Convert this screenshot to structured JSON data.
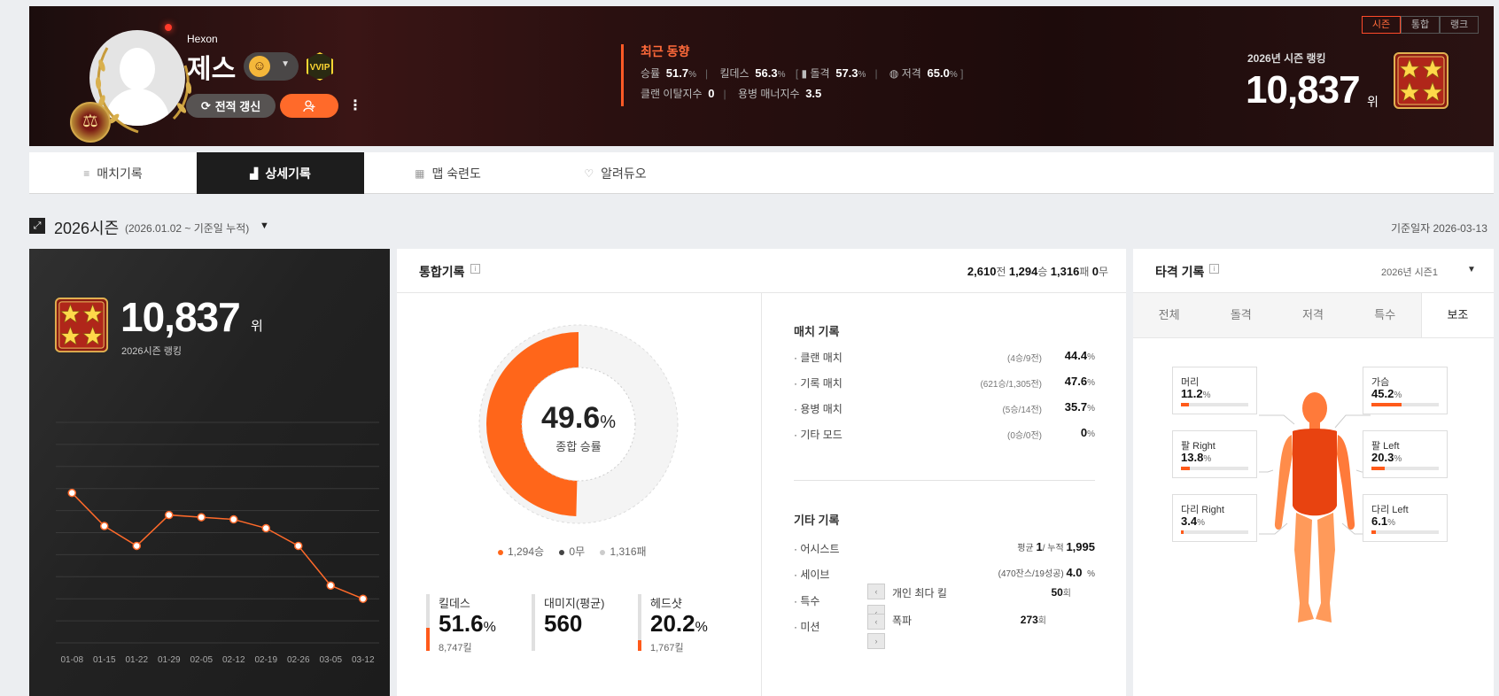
{
  "header": {
    "player_sub": "Hexon",
    "player_name": "제스",
    "vip_label": "VVIP",
    "refresh_label": "전적 갱신",
    "recent": {
      "title": "최근 동향",
      "win_rate_label": "승률",
      "win_rate": "51.7",
      "kd_label": "킬데스",
      "kd": "56.3",
      "assault_label": "돌격",
      "assault": "57.3",
      "sniper_label": "저격",
      "sniper": "65.0",
      "clan_leave_label": "클랜 이탈지수",
      "clan_leave": "0",
      "merc_manner_label": "용병 매너지수",
      "merc_manner": "3.5",
      "pct": "%"
    },
    "tabs": [
      "시즌",
      "통합",
      "랭크"
    ],
    "season_rank_label": "2026년 시즌 랭킹",
    "season_rank_value": "10,837",
    "rank_unit": "위"
  },
  "nav": [
    "매치기록",
    "상세기록",
    "맵 숙련도",
    "알려듀오"
  ],
  "season": {
    "title": "2026시즌",
    "range": "(2026.01.02 ~ 기준일 누적)",
    "base_date": "기준일자 2026-03-13"
  },
  "rank_card": {
    "value": "10,837",
    "unit": "위",
    "label": "2026시즌 랭킹",
    "chart_data": {
      "type": "line",
      "x": [
        "01-08",
        "01-15",
        "01-22",
        "01-29",
        "02-05",
        "02-12",
        "02-19",
        "02-26",
        "03-05",
        "03-12"
      ],
      "values": [
        32,
        47,
        56,
        42,
        43,
        44,
        48,
        56,
        74,
        80
      ],
      "inverted": true,
      "grid": true
    }
  },
  "combined": {
    "title": "통합기록",
    "summary": {
      "total": "2,610",
      "total_unit": "전",
      "wins": "1,294",
      "wins_unit": "승",
      "losses": "1,316",
      "losses_unit": "패",
      "draws": "0",
      "draws_unit": "무"
    },
    "win_rate_value": "49.6",
    "win_rate_label": "종합 승률",
    "legend": [
      "1,294승",
      "0무",
      "1,316패"
    ],
    "stats": [
      {
        "label": "킬데스",
        "value": "51.6",
        "unit": "%",
        "sub": "8,747킬",
        "fill": 0.45
      },
      {
        "label": "대미지(평균)",
        "value": "560",
        "unit": "",
        "sub": "",
        "fill": 0
      },
      {
        "label": "헤드샷",
        "value": "20.2",
        "unit": "%",
        "sub": "1,767킬",
        "fill": 0.2
      }
    ],
    "match_title": "매치 기록",
    "match_rows": [
      {
        "name": "· 클랜 매치",
        "detail": "(4승/9전)",
        "pct": "44.4"
      },
      {
        "name": "· 기록 매치",
        "detail": "(621승/1,305전)",
        "pct": "47.6"
      },
      {
        "name": "· 용병 매치",
        "detail": "(5승/14전)",
        "pct": "35.7"
      },
      {
        "name": "· 기타 모드",
        "detail": "(0승/0전)",
        "pct": "0"
      }
    ],
    "other_title": "기타 기록",
    "other_rows": [
      {
        "name": "· 어시스트",
        "pre": "평균",
        "a": "1",
        "mid": "/ 누적",
        "b": "1,995"
      },
      {
        "name": "· 세이브",
        "pre": "(470잔스/19성공)",
        "a": "",
        "mid": "",
        "b": "4.0"
      },
      {
        "name": "· 특수"
      },
      {
        "name": "· 미션"
      }
    ],
    "save_unit": "%",
    "popup": [
      {
        "label": "개인 최다 킬",
        "value": "50",
        "unit": "회"
      },
      {
        "label": "폭파",
        "value": "273",
        "unit": "회"
      }
    ]
  },
  "hit": {
    "title": "타격 기록",
    "season": "2026년 시즌1",
    "tabs": [
      "전체",
      "돌격",
      "저격",
      "특수",
      "보조"
    ],
    "parts": [
      {
        "label": "머리",
        "value": "11.2",
        "fill": 0.112
      },
      {
        "label": "가슴",
        "value": "45.2",
        "fill": 0.452
      },
      {
        "label": "팔  Right",
        "value": "13.8",
        "fill": 0.138
      },
      {
        "label": "팔  Left",
        "value": "20.3",
        "fill": 0.203
      },
      {
        "label": "다리  Right",
        "value": "3.4",
        "fill": 0.034
      },
      {
        "label": "다리  Left",
        "value": "6.1",
        "fill": 0.061
      }
    ],
    "pct": "%"
  },
  "colors": {
    "accent": "#ff5a1a",
    "dark": "#1d1d1d"
  }
}
